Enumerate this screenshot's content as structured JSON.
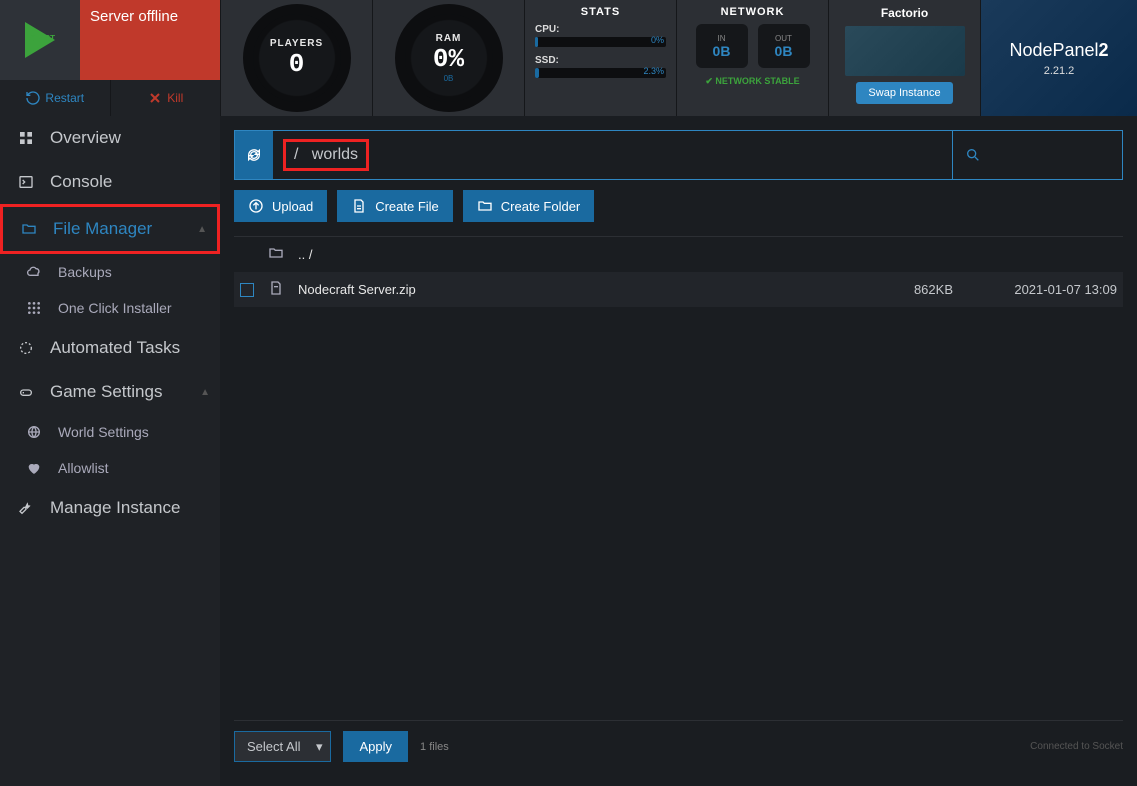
{
  "header": {
    "start_label": "START",
    "server_status": "Server offline",
    "restart": "Restart",
    "kill": "Kill",
    "players": {
      "label": "PLAYERS",
      "value": "0"
    },
    "ram": {
      "label": "RAM",
      "value": "0%",
      "sub": "0B"
    },
    "stats": {
      "title": "STATS",
      "cpu": {
        "label": "CPU:",
        "pct": "0%"
      },
      "ssd": {
        "label": "SSD:",
        "pct": "2.3%"
      }
    },
    "network": {
      "title": "NETWORK",
      "in": {
        "label": "IN",
        "value": "0B"
      },
      "out": {
        "label": "OUT",
        "value": "0B"
      },
      "stable": "NETWORK STABLE"
    },
    "game": {
      "title": "Factorio",
      "swap": "Swap Instance"
    },
    "brand": {
      "name1": "NodePanel",
      "name2": "2",
      "version": "2.21.2"
    }
  },
  "sidebar": {
    "overview": "Overview",
    "console": "Console",
    "file_manager": "File Manager",
    "backups": "Backups",
    "one_click": "One Click Installer",
    "automated": "Automated Tasks",
    "game_settings": "Game Settings",
    "world_settings": "World Settings",
    "allowlist": "Allowlist",
    "manage": "Manage Instance"
  },
  "path": {
    "root": "/",
    "segment": "worlds"
  },
  "actions": {
    "upload": "Upload",
    "create_file": "Create File",
    "create_folder": "Create Folder"
  },
  "files": {
    "parent": ".. /",
    "row1": {
      "name": "Nodecraft Server.zip",
      "size": "862KB",
      "date": "2021-01-07 13:09"
    }
  },
  "footer": {
    "select_all": "Select All",
    "apply": "Apply",
    "count": "1 files",
    "socket": "Connected to Socket"
  }
}
